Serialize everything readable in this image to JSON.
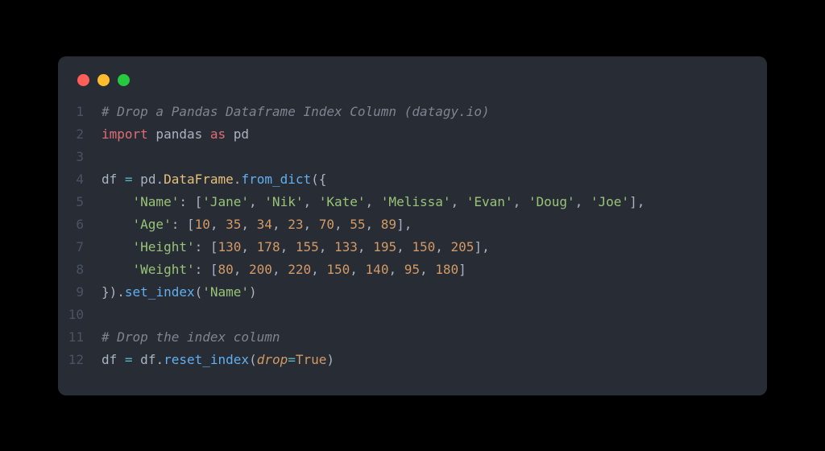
{
  "window": {
    "traffic_lights": [
      "red",
      "yellow",
      "green"
    ]
  },
  "code": {
    "lines": [
      {
        "n": "1",
        "tokens": [
          {
            "t": "# Drop a Pandas Dataframe Index Column (datagy.io)",
            "c": "tok-comment"
          }
        ]
      },
      {
        "n": "2",
        "tokens": [
          {
            "t": "import",
            "c": "tok-keyword2"
          },
          {
            "t": " pandas ",
            "c": "tok-default"
          },
          {
            "t": "as",
            "c": "tok-keyword2"
          },
          {
            "t": " pd",
            "c": "tok-default"
          }
        ]
      },
      {
        "n": "3",
        "tokens": [
          {
            "t": "",
            "c": "tok-default"
          }
        ]
      },
      {
        "n": "4",
        "tokens": [
          {
            "t": "df ",
            "c": "tok-default"
          },
          {
            "t": "=",
            "c": "tok-op"
          },
          {
            "t": " pd",
            "c": "tok-default"
          },
          {
            "t": ".",
            "c": "tok-punc"
          },
          {
            "t": "DataFrame",
            "c": "tok-ident"
          },
          {
            "t": ".",
            "c": "tok-punc"
          },
          {
            "t": "from_dict",
            "c": "tok-func"
          },
          {
            "t": "({",
            "c": "tok-punc"
          }
        ]
      },
      {
        "n": "5",
        "tokens": [
          {
            "t": "    ",
            "c": "tok-default"
          },
          {
            "t": "'Name'",
            "c": "tok-string"
          },
          {
            "t": ": [",
            "c": "tok-punc"
          },
          {
            "t": "'Jane'",
            "c": "tok-string"
          },
          {
            "t": ", ",
            "c": "tok-punc"
          },
          {
            "t": "'Nik'",
            "c": "tok-string"
          },
          {
            "t": ", ",
            "c": "tok-punc"
          },
          {
            "t": "'Kate'",
            "c": "tok-string"
          },
          {
            "t": ", ",
            "c": "tok-punc"
          },
          {
            "t": "'Melissa'",
            "c": "tok-string"
          },
          {
            "t": ", ",
            "c": "tok-punc"
          },
          {
            "t": "'Evan'",
            "c": "tok-string"
          },
          {
            "t": ", ",
            "c": "tok-punc"
          },
          {
            "t": "'Doug'",
            "c": "tok-string"
          },
          {
            "t": ", ",
            "c": "tok-punc"
          },
          {
            "t": "'Joe'",
            "c": "tok-string"
          },
          {
            "t": "],",
            "c": "tok-punc"
          }
        ]
      },
      {
        "n": "6",
        "tokens": [
          {
            "t": "    ",
            "c": "tok-default"
          },
          {
            "t": "'Age'",
            "c": "tok-string"
          },
          {
            "t": ": [",
            "c": "tok-punc"
          },
          {
            "t": "10",
            "c": "tok-number"
          },
          {
            "t": ", ",
            "c": "tok-punc"
          },
          {
            "t": "35",
            "c": "tok-number"
          },
          {
            "t": ", ",
            "c": "tok-punc"
          },
          {
            "t": "34",
            "c": "tok-number"
          },
          {
            "t": ", ",
            "c": "tok-punc"
          },
          {
            "t": "23",
            "c": "tok-number"
          },
          {
            "t": ", ",
            "c": "tok-punc"
          },
          {
            "t": "70",
            "c": "tok-number"
          },
          {
            "t": ", ",
            "c": "tok-punc"
          },
          {
            "t": "55",
            "c": "tok-number"
          },
          {
            "t": ", ",
            "c": "tok-punc"
          },
          {
            "t": "89",
            "c": "tok-number"
          },
          {
            "t": "],",
            "c": "tok-punc"
          }
        ]
      },
      {
        "n": "7",
        "tokens": [
          {
            "t": "    ",
            "c": "tok-default"
          },
          {
            "t": "'Height'",
            "c": "tok-string"
          },
          {
            "t": ": [",
            "c": "tok-punc"
          },
          {
            "t": "130",
            "c": "tok-number"
          },
          {
            "t": ", ",
            "c": "tok-punc"
          },
          {
            "t": "178",
            "c": "tok-number"
          },
          {
            "t": ", ",
            "c": "tok-punc"
          },
          {
            "t": "155",
            "c": "tok-number"
          },
          {
            "t": ", ",
            "c": "tok-punc"
          },
          {
            "t": "133",
            "c": "tok-number"
          },
          {
            "t": ", ",
            "c": "tok-punc"
          },
          {
            "t": "195",
            "c": "tok-number"
          },
          {
            "t": ", ",
            "c": "tok-punc"
          },
          {
            "t": "150",
            "c": "tok-number"
          },
          {
            "t": ", ",
            "c": "tok-punc"
          },
          {
            "t": "205",
            "c": "tok-number"
          },
          {
            "t": "],",
            "c": "tok-punc"
          }
        ]
      },
      {
        "n": "8",
        "tokens": [
          {
            "t": "    ",
            "c": "tok-default"
          },
          {
            "t": "'Weight'",
            "c": "tok-string"
          },
          {
            "t": ": [",
            "c": "tok-punc"
          },
          {
            "t": "80",
            "c": "tok-number"
          },
          {
            "t": ", ",
            "c": "tok-punc"
          },
          {
            "t": "200",
            "c": "tok-number"
          },
          {
            "t": ", ",
            "c": "tok-punc"
          },
          {
            "t": "220",
            "c": "tok-number"
          },
          {
            "t": ", ",
            "c": "tok-punc"
          },
          {
            "t": "150",
            "c": "tok-number"
          },
          {
            "t": ", ",
            "c": "tok-punc"
          },
          {
            "t": "140",
            "c": "tok-number"
          },
          {
            "t": ", ",
            "c": "tok-punc"
          },
          {
            "t": "95",
            "c": "tok-number"
          },
          {
            "t": ", ",
            "c": "tok-punc"
          },
          {
            "t": "180",
            "c": "tok-number"
          },
          {
            "t": "]",
            "c": "tok-punc"
          }
        ]
      },
      {
        "n": "9",
        "tokens": [
          {
            "t": "}).",
            "c": "tok-punc"
          },
          {
            "t": "set_index",
            "c": "tok-func"
          },
          {
            "t": "(",
            "c": "tok-punc"
          },
          {
            "t": "'Name'",
            "c": "tok-string"
          },
          {
            "t": ")",
            "c": "tok-punc"
          }
        ]
      },
      {
        "n": "10",
        "tokens": [
          {
            "t": "",
            "c": "tok-default"
          }
        ]
      },
      {
        "n": "11",
        "tokens": [
          {
            "t": "# Drop the index column",
            "c": "tok-comment"
          }
        ]
      },
      {
        "n": "12",
        "tokens": [
          {
            "t": "df ",
            "c": "tok-default"
          },
          {
            "t": "=",
            "c": "tok-op"
          },
          {
            "t": " df",
            "c": "tok-default"
          },
          {
            "t": ".",
            "c": "tok-punc"
          },
          {
            "t": "reset_index",
            "c": "tok-func"
          },
          {
            "t": "(",
            "c": "tok-punc"
          },
          {
            "t": "drop",
            "c": "tok-param"
          },
          {
            "t": "=",
            "c": "tok-op"
          },
          {
            "t": "True",
            "c": "tok-const"
          },
          {
            "t": ")",
            "c": "tok-punc"
          }
        ]
      }
    ]
  }
}
